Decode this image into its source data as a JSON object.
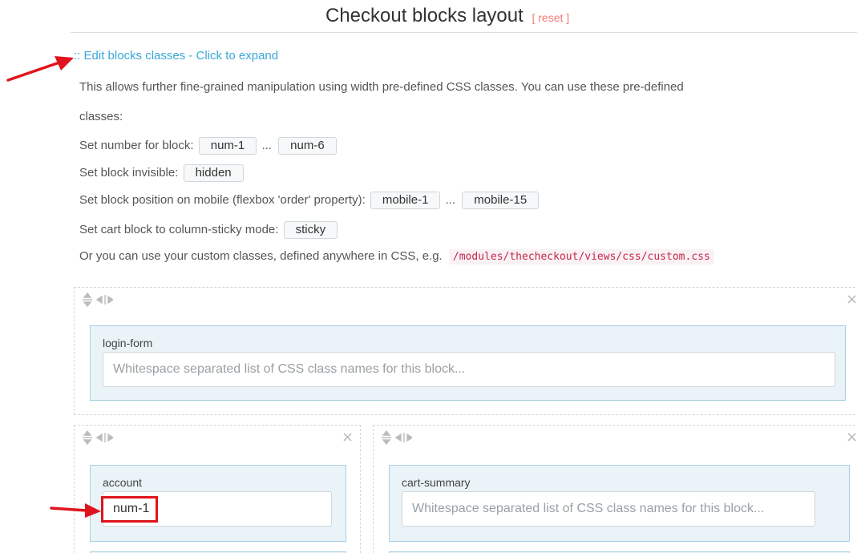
{
  "header": {
    "title": "Checkout blocks layout",
    "reset_label": "[ reset ]"
  },
  "expand": {
    "prefix": "::",
    "label": "Edit blocks classes - Click to expand"
  },
  "description": {
    "line1": "This allows further fine-grained manipulation using width pre-defined CSS classes. You can use these pre-defined",
    "line2": "classes:",
    "number_label": "Set number for block:",
    "number_from": "num-1",
    "number_to": "num-6",
    "invisible_label": "Set block invisible:",
    "invisible_class": "hidden",
    "mobile_label": "Set block position on mobile (flexbox 'order' property):",
    "mobile_from": "mobile-1",
    "mobile_to": "mobile-15",
    "sticky_label": "Set cart block to column-sticky mode:",
    "sticky_class": "sticky",
    "custom_label": "Or you can use your custom classes, defined anywhere in CSS, e.g.",
    "custom_path": "/modules/thecheckout/views/css/custom.css",
    "ellipsis": "..."
  },
  "icons": {
    "close": "×",
    "close_icon": "close-icon",
    "move_icon": "move-vertical-icon",
    "resize_icon": "resize-horizontal-icon"
  },
  "blocks": {
    "login_form": {
      "name": "login-form",
      "value": "",
      "placeholder": "Whitespace separated list of CSS class names for this block..."
    },
    "account": {
      "name": "account",
      "value": "num-1",
      "placeholder": "Whitespace separated list of CSS class names for this block..."
    },
    "cart_summary": {
      "name": "cart-summary",
      "value": "",
      "placeholder": "Whitespace separated list of CSS class names for this block..."
    }
  },
  "colors": {
    "link": "#3aa8d8",
    "reset": "#f07b73",
    "card_bg": "#eaf3f8",
    "card_border": "#a9cfe2",
    "annotation": "#e0141d",
    "code": "#c7254e"
  }
}
